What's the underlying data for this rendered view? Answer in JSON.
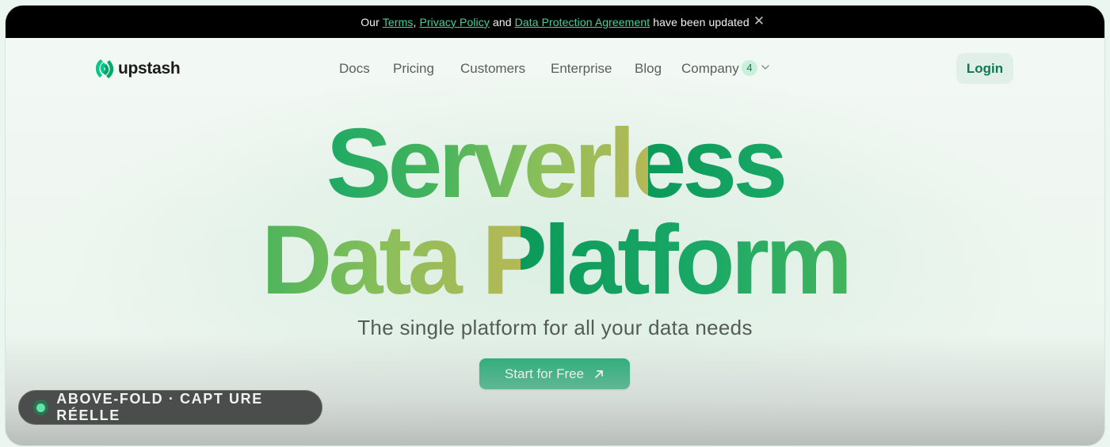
{
  "announcement": {
    "prefix": "Our ",
    "link_terms": "Terms",
    "comma": ", ",
    "link_privacy": "Privacy Policy",
    "and": " and ",
    "link_dpa": "Data Protection Agreement",
    "suffix": " have been updated",
    "close_icon": "close-icon"
  },
  "brand": {
    "name": "upstash",
    "icon": "upstash-logo-icon",
    "color": "#00a86b"
  },
  "nav": {
    "items": [
      "Docs",
      "Pricing",
      "Customers",
      "Enterprise",
      "Blog"
    ],
    "company_label": "Company",
    "company_badge": "4",
    "company_icon": "chevron-down-icon",
    "login_label": "Login"
  },
  "hero": {
    "line1": "Serverless",
    "line2": "Data Platform",
    "tagline": "The single platform for all your data needs",
    "cta_label": "Start for Free",
    "cta_icon": "arrow-up-right-icon"
  },
  "overlay_badge": {
    "text": "ABOVE-FOLD · CAPT URE RÉELLE",
    "dot_color": "#5fe3a6"
  },
  "colors": {
    "accent": "#0fa86a",
    "announce_bg": "#000000",
    "link": "#3ed59c"
  }
}
